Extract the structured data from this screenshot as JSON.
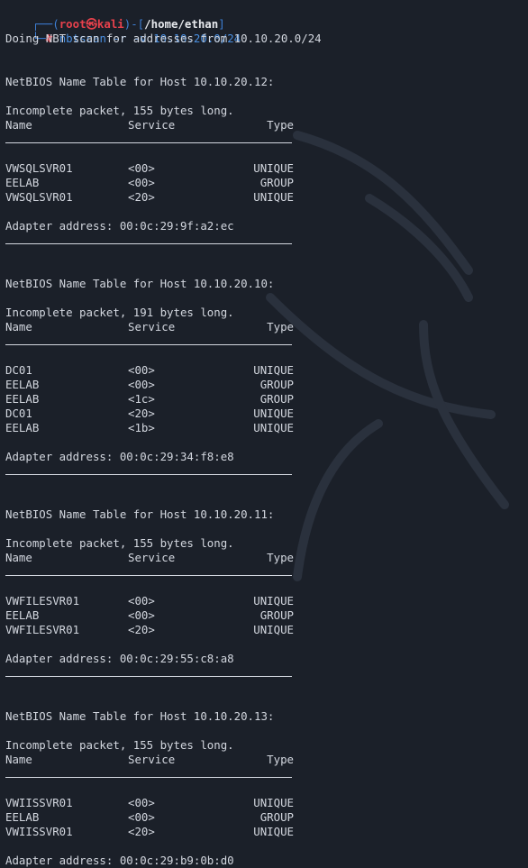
{
  "prompt": {
    "user": "root",
    "at_symbol": "㉿",
    "host": "kali",
    "cwd": "/home/ethan",
    "symbol": "#",
    "command": "nbtscan -r -v 10.10.20.0/24"
  },
  "scan_message": "Doing NBT scan for addresses from 10.10.20.0/24",
  "table_headers": {
    "name": "Name",
    "service": "Service",
    "type": "Type"
  },
  "hosts": [
    {
      "title": "NetBIOS Name Table for Host 10.10.20.12:",
      "packet": "Incomplete packet, 155 bytes long.",
      "rows": [
        {
          "name": "VWSQLSVR01",
          "service": "<00>",
          "type": "UNIQUE"
        },
        {
          "name": "EELAB",
          "service": "<00>",
          "type": "GROUP"
        },
        {
          "name": "VWSQLSVR01",
          "service": "<20>",
          "type": "UNIQUE"
        }
      ],
      "adapter": "Adapter address: 00:0c:29:9f:a2:ec"
    },
    {
      "title": "NetBIOS Name Table for Host 10.10.20.10:",
      "packet": "Incomplete packet, 191 bytes long.",
      "rows": [
        {
          "name": "DC01",
          "service": "<00>",
          "type": "UNIQUE"
        },
        {
          "name": "EELAB",
          "service": "<00>",
          "type": "GROUP"
        },
        {
          "name": "EELAB",
          "service": "<1c>",
          "type": "GROUP"
        },
        {
          "name": "DC01",
          "service": "<20>",
          "type": "UNIQUE"
        },
        {
          "name": "EELAB",
          "service": "<1b>",
          "type": "UNIQUE"
        }
      ],
      "adapter": "Adapter address: 00:0c:29:34:f8:e8"
    },
    {
      "title": "NetBIOS Name Table for Host 10.10.20.11:",
      "packet": "Incomplete packet, 155 bytes long.",
      "rows": [
        {
          "name": "VWFILESVR01",
          "service": "<00>",
          "type": "UNIQUE"
        },
        {
          "name": "EELAB",
          "service": "<00>",
          "type": "GROUP"
        },
        {
          "name": "VWFILESVR01",
          "service": "<20>",
          "type": "UNIQUE"
        }
      ],
      "adapter": "Adapter address: 00:0c:29:55:c8:a8"
    },
    {
      "title": "NetBIOS Name Table for Host 10.10.20.13:",
      "packet": "Incomplete packet, 155 bytes long.",
      "rows": [
        {
          "name": "VWIISSVR01",
          "service": "<00>",
          "type": "UNIQUE"
        },
        {
          "name": "EELAB",
          "service": "<00>",
          "type": "GROUP"
        },
        {
          "name": "VWIISSVR01",
          "service": "<20>",
          "type": "UNIQUE"
        }
      ],
      "adapter": "Adapter address: 00:0c:29:b9:0b:d0"
    }
  ],
  "colors": {
    "background": "#1b2029",
    "text": "#d3d7df",
    "prompt_frame": "#3d7fd6",
    "prompt_user": "#e8414c",
    "command": "#4a8fe0"
  }
}
